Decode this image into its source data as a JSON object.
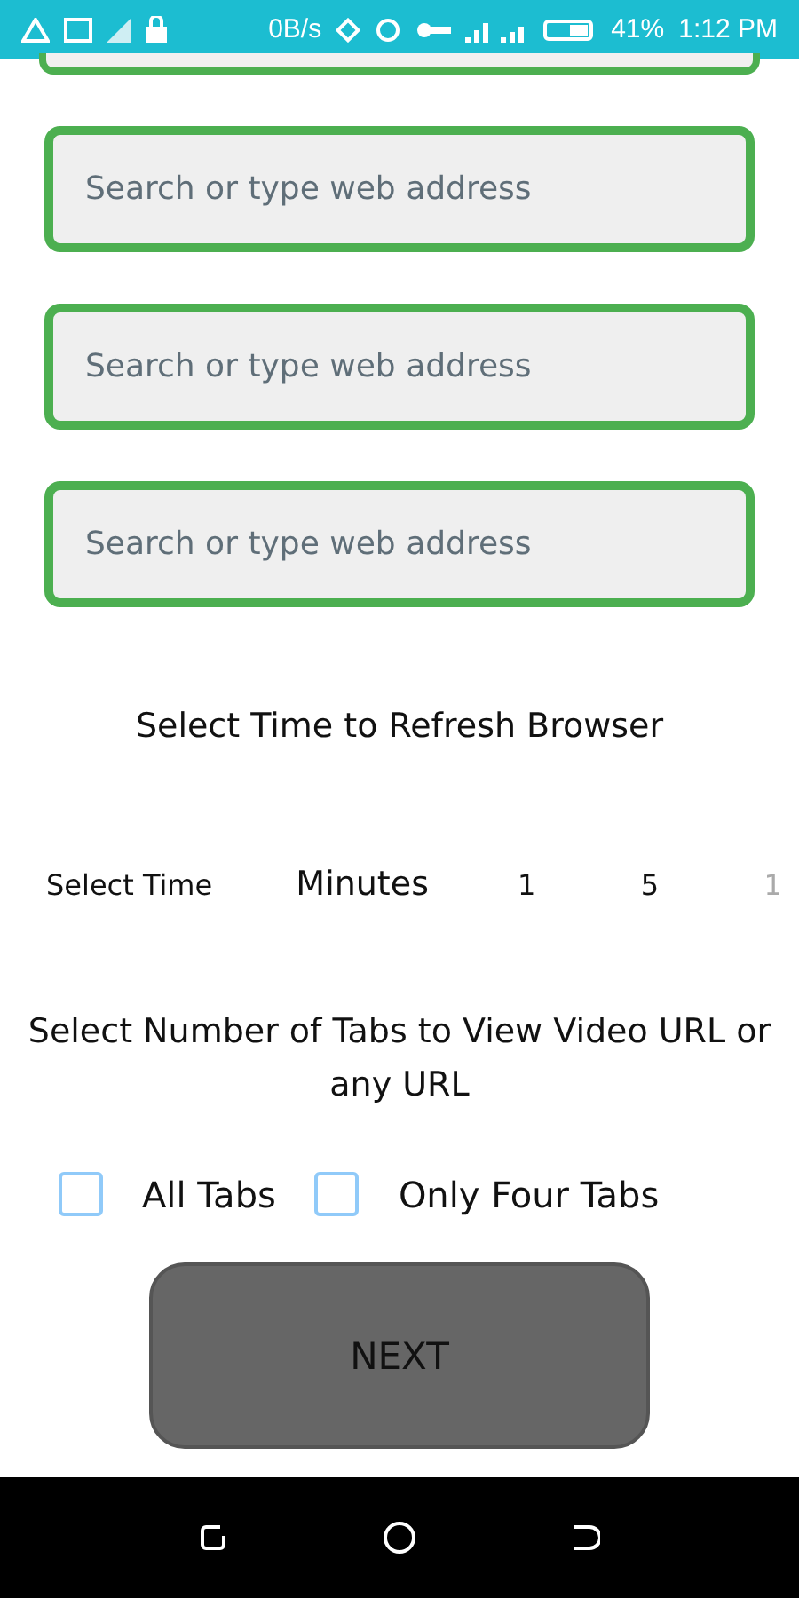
{
  "status_bar": {
    "speed": "0B/s",
    "battery": "41%",
    "time": "1:12 PM"
  },
  "url_fields": [
    {
      "placeholder": "Search or type web address"
    },
    {
      "placeholder": "Search or type web address"
    },
    {
      "placeholder": "Search or type web address"
    }
  ],
  "refresh_title": "Select Time to Refresh Browser",
  "time_picker": {
    "label": "Select Time",
    "unit": "Minutes",
    "options": [
      {
        "label": "1",
        "selected": true
      },
      {
        "label": "5",
        "selected": true
      },
      {
        "label": "1",
        "selected": false
      }
    ]
  },
  "tabs_title": "Select Number of Tabs to View Video URL or any URL",
  "tab_options": [
    {
      "label": "All Tabs",
      "checked": false
    },
    {
      "label": "Only Four Tabs",
      "checked": false
    }
  ],
  "next_button": "NEXT"
}
